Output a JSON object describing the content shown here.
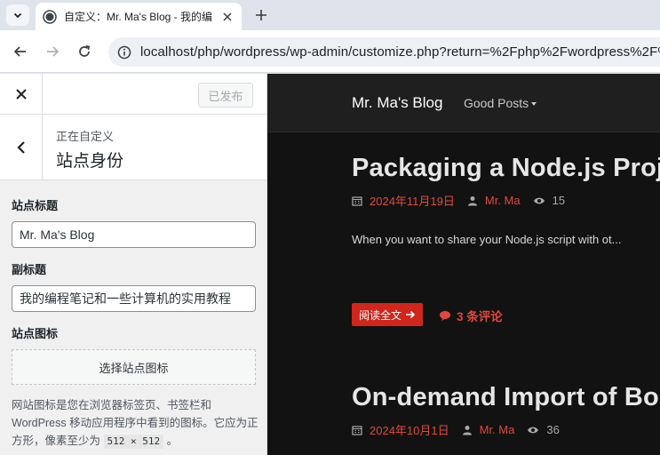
{
  "browser": {
    "tab": {
      "title": "自定义：Mr. Ma's Blog - 我的编"
    },
    "url": "localhost/php/wordpress/wp-admin/customize.php?return=%2Fphp%2Fwordpress%2F%",
    "colors": {
      "tabstrip": "#dfe3eb",
      "omnibox": "#edf0f5"
    }
  },
  "customizer": {
    "publish_label": "已发布",
    "crumb": "正在自定义",
    "section_title": "站点身份",
    "site_title_label": "站点标题",
    "site_title_value": "Mr. Ma's Blog",
    "tagline_label": "副标题",
    "tagline_value": "我的编程笔记和一些计算机的实用教程",
    "icon_label": "站点图标",
    "icon_button": "选择站点图标",
    "icon_desc": "网站图标是您在浏览器标签页、书签栏和WordPress 移动应用程序中看到的图标。它应为正方形，像素至少为",
    "icon_size": "512 × 512",
    "icon_desc_end": "。"
  },
  "preview": {
    "brand": "Mr. Ma's Blog",
    "menu_item": "Good Posts",
    "colors": {
      "accent": "#e2483d",
      "button": "#d0261c",
      "background": "#121212"
    },
    "posts": [
      {
        "title": "Packaging a Node.js Project",
        "date": "2024年11月19日",
        "author": "Mr. Ma",
        "views": "15",
        "excerpt": "When you want to share your Node.js script with ot...",
        "read_more": "阅读全文",
        "comments": "3 条评论"
      },
      {
        "title": "On-demand Import of Bo",
        "date": "2024年10月1日",
        "author": "Mr. Ma",
        "views": "36"
      }
    ]
  }
}
